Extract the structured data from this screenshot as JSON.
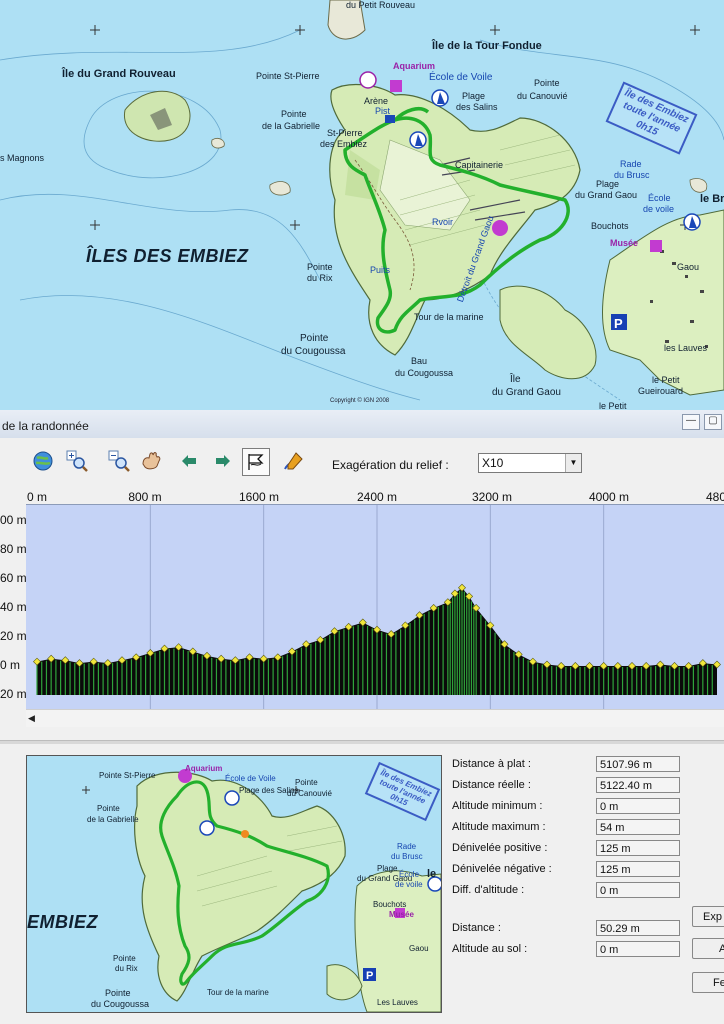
{
  "map": {
    "labels": {
      "petit_rouveau": "du Petit Rouveau",
      "tour_fondue": "Île de la Tour Fondue",
      "grand_rouveau": "Île du Grand Rouveau",
      "pointe_st_pierre": "Pointe St-Pierre",
      "aquarium": "Aquarium",
      "ecole_voile": "École de Voile",
      "pointe_canouvie_1": "Pointe",
      "pointe_canouvie_2": "du Canouvié",
      "plage_salins_1": "Plage",
      "plage_salins_2": "des Salins",
      "pointe_gabrielle_1": "Pointe",
      "pointe_gabrielle_2": "de la Gabrielle",
      "st_pierre_1": "St-Pierre",
      "st_pierre_2": "des Embiez",
      "arene": "Arène",
      "piste": "Pist",
      "magnons": "s Magnons",
      "iles_des_embiez": "ÎLES DES EMBIEZ",
      "pointe_rix_1": "Pointe",
      "pointe_rix_2": "du Rix",
      "pointe_cougoussa_1": "Pointe",
      "pointe_cougoussa_2": "du Cougoussa",
      "bau_1": "Bau",
      "bau_2": "du Cougoussa",
      "tour_marine": "Tour de la marine",
      "capitainerie": "Capitainerie",
      "rade_1": "Rade",
      "rade_2": "du Brusc",
      "plage_gaou_1": "Plage",
      "plage_gaou_2": "du Grand Gaou",
      "ecole_voile_2_1": "École",
      "ecole_voile_2_2": "de voile",
      "bouchots": "Bouchots",
      "musee": "Musée",
      "le_brusc": "le Br",
      "gaou": "Gaou",
      "les_lauves": "les Lauves",
      "ile_gaou_1": "Île",
      "ile_gaou_2": "du Grand Gaou",
      "petit_gueirouard_1": "le Petit",
      "petit_gueirouard_2": "Gueirouard",
      "le_petit": "le Petit",
      "detroit": "Détroit du Grand Gaou",
      "puits": "Puits",
      "pvoir": "Rvoir",
      "copyright": "Copyright © IGN 2008"
    },
    "stamp": [
      "Île des Embiez",
      "toute l'année",
      "0h15"
    ],
    "mini_stamp": [
      "Île des Embiez",
      "toute l'année",
      "0h15"
    ]
  },
  "window": {
    "title": "de la randonnée",
    "controls": [
      "—",
      "▢"
    ]
  },
  "toolbar": {
    "relief_label": "Exagération du relief :",
    "relief_value": "X10",
    "icons": [
      "globe-icon",
      "zoom-in-icon",
      "zoom-out-icon",
      "pan-hand-icon",
      "arrow-left-icon",
      "arrow-right-icon",
      "profile-flag-icon",
      "path-tool-icon"
    ]
  },
  "profile": {
    "x_ticks": [
      "0 m",
      "800 m",
      "1600 m",
      "2400 m",
      "3200 m",
      "4000 m",
      "480"
    ],
    "y_ticks": [
      "00 m",
      "80 m",
      "60 m",
      "40 m",
      "20 m",
      "0 m",
      "20 m"
    ],
    "x_range_m": [
      0,
      4800
    ],
    "y_range_m": [
      -20,
      100
    ],
    "colors": {
      "background": "#c5d3f6",
      "fill_dark": "#0a0a0a",
      "fill_green": "#2fa33a",
      "point": "#f2e63d"
    },
    "elevation_m": [
      [
        0,
        3
      ],
      [
        100,
        5
      ],
      [
        200,
        4
      ],
      [
        300,
        2
      ],
      [
        400,
        3
      ],
      [
        500,
        2
      ],
      [
        600,
        4
      ],
      [
        700,
        6
      ],
      [
        800,
        9
      ],
      [
        900,
        12
      ],
      [
        1000,
        13
      ],
      [
        1100,
        10
      ],
      [
        1200,
        7
      ],
      [
        1300,
        5
      ],
      [
        1400,
        4
      ],
      [
        1500,
        6
      ],
      [
        1600,
        5
      ],
      [
        1700,
        6
      ],
      [
        1800,
        10
      ],
      [
        1900,
        15
      ],
      [
        2000,
        18
      ],
      [
        2100,
        24
      ],
      [
        2200,
        27
      ],
      [
        2300,
        30
      ],
      [
        2400,
        25
      ],
      [
        2500,
        22
      ],
      [
        2600,
        28
      ],
      [
        2700,
        35
      ],
      [
        2800,
        40
      ],
      [
        2900,
        44
      ],
      [
        2950,
        50
      ],
      [
        3000,
        54
      ],
      [
        3050,
        48
      ],
      [
        3100,
        40
      ],
      [
        3200,
        28
      ],
      [
        3300,
        15
      ],
      [
        3400,
        8
      ],
      [
        3500,
        3
      ],
      [
        3600,
        1
      ],
      [
        3700,
        0
      ],
      [
        3800,
        0
      ],
      [
        3900,
        0
      ],
      [
        4000,
        0
      ],
      [
        4100,
        0
      ],
      [
        4200,
        0
      ],
      [
        4300,
        0
      ],
      [
        4400,
        1
      ],
      [
        4500,
        0
      ],
      [
        4600,
        0
      ],
      [
        4700,
        2
      ],
      [
        4800,
        1
      ]
    ]
  },
  "stats": {
    "rows": [
      {
        "label": "Distance à plat :",
        "value": "5107.96 m"
      },
      {
        "label": "Distance réelle :",
        "value": "5122.40 m"
      },
      {
        "label": "Altitude minimum :",
        "value": "0 m"
      },
      {
        "label": "Altitude maximum :",
        "value": "54 m"
      },
      {
        "label": "Dénivelée positive :",
        "value": "125 m"
      },
      {
        "label": "Dénivelée négative :",
        "value": "125 m"
      },
      {
        "label": "Diff. d'altitude :",
        "value": "0 m"
      }
    ],
    "cursor_rows": [
      {
        "label": "Distance :",
        "value": "50.29 m"
      },
      {
        "label": "Altitude au sol :",
        "value": "0 m"
      }
    ],
    "buttons": [
      "Exp",
      "A",
      "Fe"
    ]
  },
  "mini_map": {
    "labels": {
      "aquarium": "Aquarium",
      "pointe_st_pierre": "Pointe St-Pierre",
      "ecole_voile": "École de Voile",
      "plage_salins": "Plage des Salins",
      "pointe_1": "Pointe",
      "pointe_2": "du Canouvié",
      "pointe_gab_1": "Pointe",
      "pointe_gab_2": "de la Gabrielle",
      "embiez": "EMBIEZ",
      "rade_1": "Rade",
      "rade_2": "du Brusc",
      "plage_gaou_1": "Plage",
      "plage_gaou_2": "du Grand Gaou",
      "bouchots": "Bouchots",
      "ecole_1": "École",
      "ecole_2": "de voile",
      "le": "le",
      "musee": "Musée",
      "pointe_rix_1": "Pointe",
      "pointe_rix_2": "du Rix",
      "pointe_coug_1": "Pointe",
      "pointe_coug_2": "du Cougoussa",
      "tour": "Tour de la marine",
      "gaou": "Gaou",
      "lauves": "Les Lauves"
    }
  }
}
